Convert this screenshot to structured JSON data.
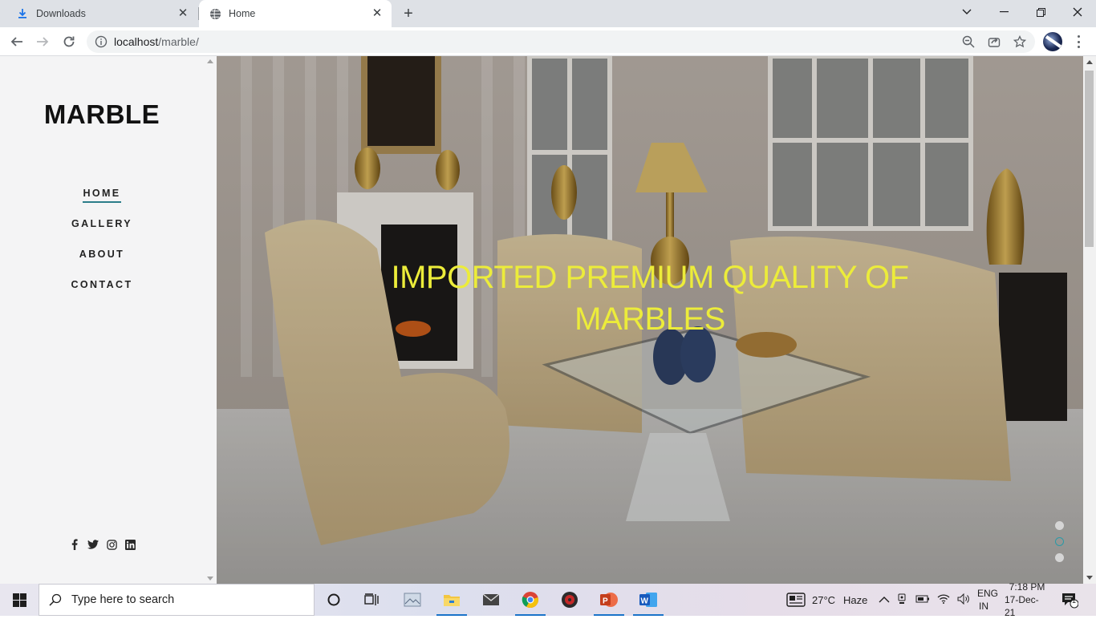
{
  "browser": {
    "tabs": [
      {
        "label": "Downloads",
        "icon": "download-icon"
      },
      {
        "label": "Home",
        "icon": "globe-icon"
      }
    ],
    "url_host": "localhost",
    "url_path": "/marble/"
  },
  "site": {
    "logo": "MARBLE",
    "menu": [
      "HOME",
      "GALLERY",
      "ABOUT",
      "CONTACT"
    ],
    "active_menu": "HOME",
    "social": [
      "facebook-icon",
      "twitter-icon",
      "instagram-icon",
      "linkedin-icon"
    ],
    "hero_title": "IMPORTED PREMIUM QUALITY OF MARBLES",
    "slider_dots": 3,
    "active_dot": 1,
    "accent": "#2b7d8a",
    "hero_title_color": "#ecec3a"
  },
  "taskbar": {
    "search_placeholder": "Type here to search",
    "weather_temp": "27°C",
    "weather_text": "Haze",
    "lang_1": "ENG",
    "lang_2": "IN",
    "time": "7:18 PM",
    "date": "17-Dec-21",
    "notification_count": "1"
  }
}
